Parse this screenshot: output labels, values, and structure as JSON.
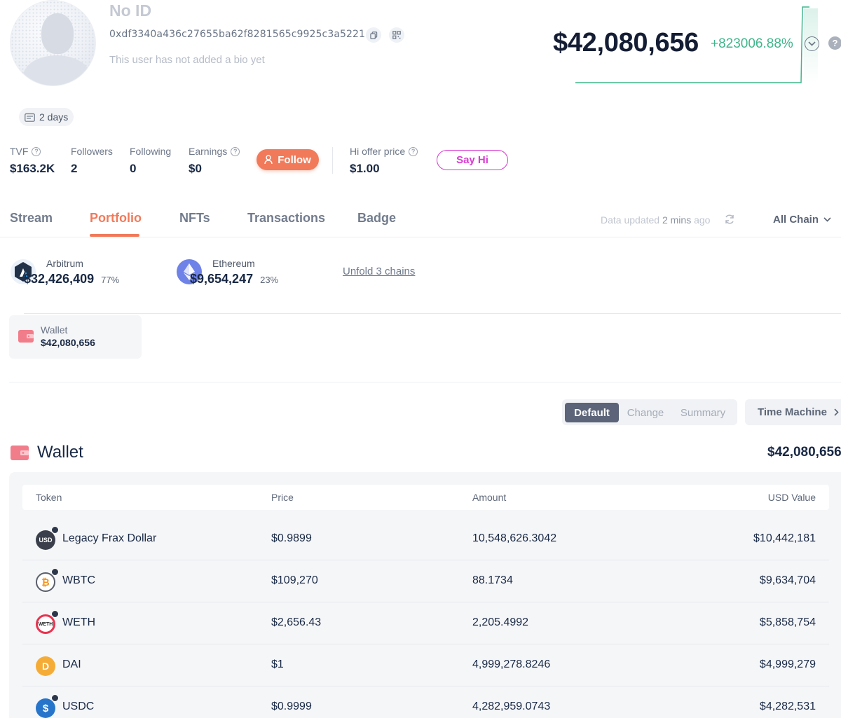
{
  "profile": {
    "name": "No ID",
    "address": "0xdf3340a436c27655ba62f8281565c9925c3a5221",
    "bio": "This user has not added a bio yet",
    "age_chip": "2 days",
    "total_value": "$42,080,656",
    "total_change": "+823006.88%"
  },
  "stats": {
    "tvf_label": "TVF",
    "tvf_value": "$163.2K",
    "followers_label": "Followers",
    "followers_value": "2",
    "following_label": "Following",
    "following_value": "0",
    "earnings_label": "Earnings",
    "earnings_value": "$0",
    "follow_label": "Follow",
    "hi_offer_label": "Hi offer price",
    "hi_offer_value": "$1.00",
    "say_hi_label": "Say Hi"
  },
  "tabs": [
    {
      "label": "Stream"
    },
    {
      "label": "Portfolio"
    },
    {
      "label": "NFTs"
    },
    {
      "label": "Transactions"
    },
    {
      "label": "Badge"
    }
  ],
  "active_tab": "Portfolio",
  "data_updated": {
    "prefix": "Data updated",
    "time": "2 mins",
    "suffix": "ago"
  },
  "chain_filter": "All Chain",
  "chains": [
    {
      "name": "Arbitrum",
      "value": "$32,426,409",
      "pct": "77%"
    },
    {
      "name": "Ethereum",
      "value": "$9,654,247",
      "pct": "23%"
    }
  ],
  "unfold_label": "Unfold 3 chains",
  "wallet_card": {
    "label": "Wallet",
    "value": "$42,080,656"
  },
  "view_toggle": {
    "options": [
      "Default",
      "Change",
      "Summary"
    ],
    "selected": "Default",
    "time_machine": "Time Machine"
  },
  "wallet_section": {
    "title": "Wallet",
    "total": "$42,080,656",
    "columns": [
      "Token",
      "Price",
      "Amount",
      "USD Value"
    ],
    "rows": [
      {
        "token": "Legacy Frax Dollar",
        "price": "$0.9899",
        "amount": "10,548,626.3042",
        "usd": "$10,442,181",
        "icon_text": "USD"
      },
      {
        "token": "WBTC",
        "price": "$109,270",
        "amount": "88.1734",
        "usd": "$9,634,704",
        "icon_text": "₿"
      },
      {
        "token": "WETH",
        "price": "$2,656.43",
        "amount": "2,205.4992",
        "usd": "$5,858,754",
        "icon_text": "WETH"
      },
      {
        "token": "DAI",
        "price": "$1",
        "amount": "4,999,278.8246",
        "usd": "$4,999,279",
        "icon_text": "D"
      },
      {
        "token": "USDC",
        "price": "$0.9999",
        "amount": "4,282,959.0743",
        "usd": "$4,282,531",
        "icon_text": "$"
      }
    ]
  },
  "colors": {
    "accent": "#f17a5a",
    "positive": "#3fb68b",
    "say_hi": "#d93ad2",
    "dark_text": "#192945"
  }
}
